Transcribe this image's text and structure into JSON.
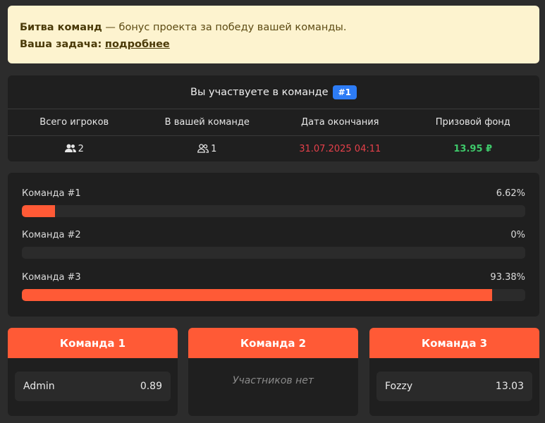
{
  "notice": {
    "title": "Битва команд",
    "text": " — бонус проекта за победу вашей команды.",
    "task_label": "Ваша задача:",
    "task_link": "подробнее"
  },
  "team_info": {
    "heading": "Вы участвуете в команде",
    "team_badge": "#1",
    "labels": [
      "Всего игроков",
      "В вашей команде",
      "Дата окончания",
      "Призовой фонд"
    ],
    "total_players": "2",
    "in_your_team": "1",
    "end_date": "31.07.2025 04:11",
    "prize_fund": "13.95 ₽"
  },
  "progress": [
    {
      "label": "Команда #1",
      "percent_text": "6.62%",
      "percent": 6.62
    },
    {
      "label": "Команда #2",
      "percent_text": "0%",
      "percent": 0
    },
    {
      "label": "Команда #3",
      "percent_text": "93.38%",
      "percent": 93.38
    }
  ],
  "teams": [
    {
      "title": "Команда 1",
      "member_name": "Admin",
      "member_value": "0.89"
    },
    {
      "title": "Команда 2",
      "empty_text": "Участников нет"
    },
    {
      "title": "Команда 3",
      "member_name": "Fozzy",
      "member_value": "13.03"
    }
  ],
  "colors": {
    "accent": "#ff5a36",
    "badge": "#2d7cf6",
    "date": "#e5404a",
    "prize": "#3ec86a",
    "notice_bg": "#fdf3cf"
  }
}
